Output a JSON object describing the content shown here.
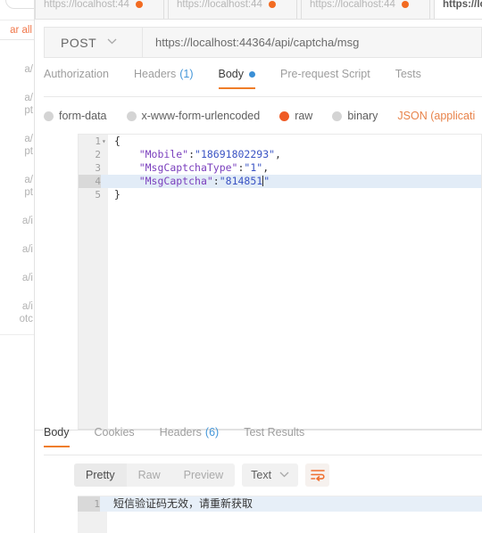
{
  "app": "Postman",
  "sidebar": {
    "clear_all_label": "ar all",
    "history_items": [
      "a/",
      "a/",
      "pt",
      "a/",
      "pt",
      "a/",
      "pt",
      "a/i",
      "a/i",
      "a/i",
      "a/i",
      "otc"
    ]
  },
  "tabstrip": {
    "tabs": [
      {
        "label": "https://localhost:44",
        "unsaved": true,
        "active": false
      },
      {
        "label": "https://localhost:44",
        "unsaved": true,
        "active": false
      },
      {
        "label": "https://localhost:44",
        "unsaved": true,
        "active": false
      },
      {
        "label": "https://loca",
        "unsaved": false,
        "active": true
      }
    ]
  },
  "request": {
    "method": "POST",
    "method_caret": "⌄",
    "url": "https://localhost:44364/api/captcha/msg",
    "tabs": [
      {
        "label": "Authorization",
        "count": "",
        "active": false,
        "dot": false
      },
      {
        "label": "Headers",
        "count": "(1)",
        "active": false,
        "dot": false
      },
      {
        "label": "Body",
        "count": "",
        "active": true,
        "dot": true
      },
      {
        "label": "Pre-request Script",
        "count": "",
        "active": false,
        "dot": false
      },
      {
        "label": "Tests",
        "count": "",
        "active": false,
        "dot": false
      }
    ],
    "body_types": [
      {
        "label": "form-data",
        "checked": false
      },
      {
        "label": "x-www-form-urlencoded",
        "checked": false
      },
      {
        "label": "raw",
        "checked": true
      },
      {
        "label": "binary",
        "checked": false
      }
    ],
    "content_type": "JSON (applicati",
    "editor": {
      "lines": [
        {
          "num": "1",
          "fold": "▾",
          "text": "{",
          "highlight": false
        },
        {
          "num": "2",
          "fold": "",
          "text": "    \"Mobile\":\"18691802293\",",
          "highlight": false
        },
        {
          "num": "3",
          "fold": "",
          "text": "    \"MsgCaptchaType\":\"1\",",
          "highlight": false
        },
        {
          "num": "4",
          "fold": "",
          "text": "    \"MsgCaptcha\":\"814851\"",
          "highlight": true
        },
        {
          "num": "5",
          "fold": "",
          "text": "}",
          "highlight": false
        }
      ],
      "json_body": {
        "Mobile": "18691802293",
        "MsgCaptchaType": "1",
        "MsgCaptcha": "814851"
      }
    }
  },
  "response": {
    "tabs": [
      {
        "label": "Body",
        "count": "",
        "active": true
      },
      {
        "label": "Cookies",
        "count": "",
        "active": false
      },
      {
        "label": "Headers",
        "count": "(6)",
        "active": false
      },
      {
        "label": "Test Results",
        "count": "",
        "active": false
      }
    ],
    "view_modes": [
      {
        "label": "Pretty",
        "active": true
      },
      {
        "label": "Raw",
        "active": false
      },
      {
        "label": "Preview",
        "active": false
      }
    ],
    "format": "Text",
    "format_caret": "⌄",
    "wrap_icon": "word-wrap-icon",
    "body_lines": [
      {
        "num": "1",
        "text": "短信验证码无效，请重新获取"
      }
    ]
  },
  "colors": {
    "accent_orange": "#ef7d28",
    "tab_dot_orange": "#f26b21",
    "radio_orange": "#ef5b25",
    "link_blue": "#4597d9",
    "body_dot_blue": "#3a8fd6",
    "content_type_orange": "#e8834a",
    "json_key": "#7a3fbd",
    "json_string": "#3b54c4",
    "active_line": "#e2ecf7"
  }
}
